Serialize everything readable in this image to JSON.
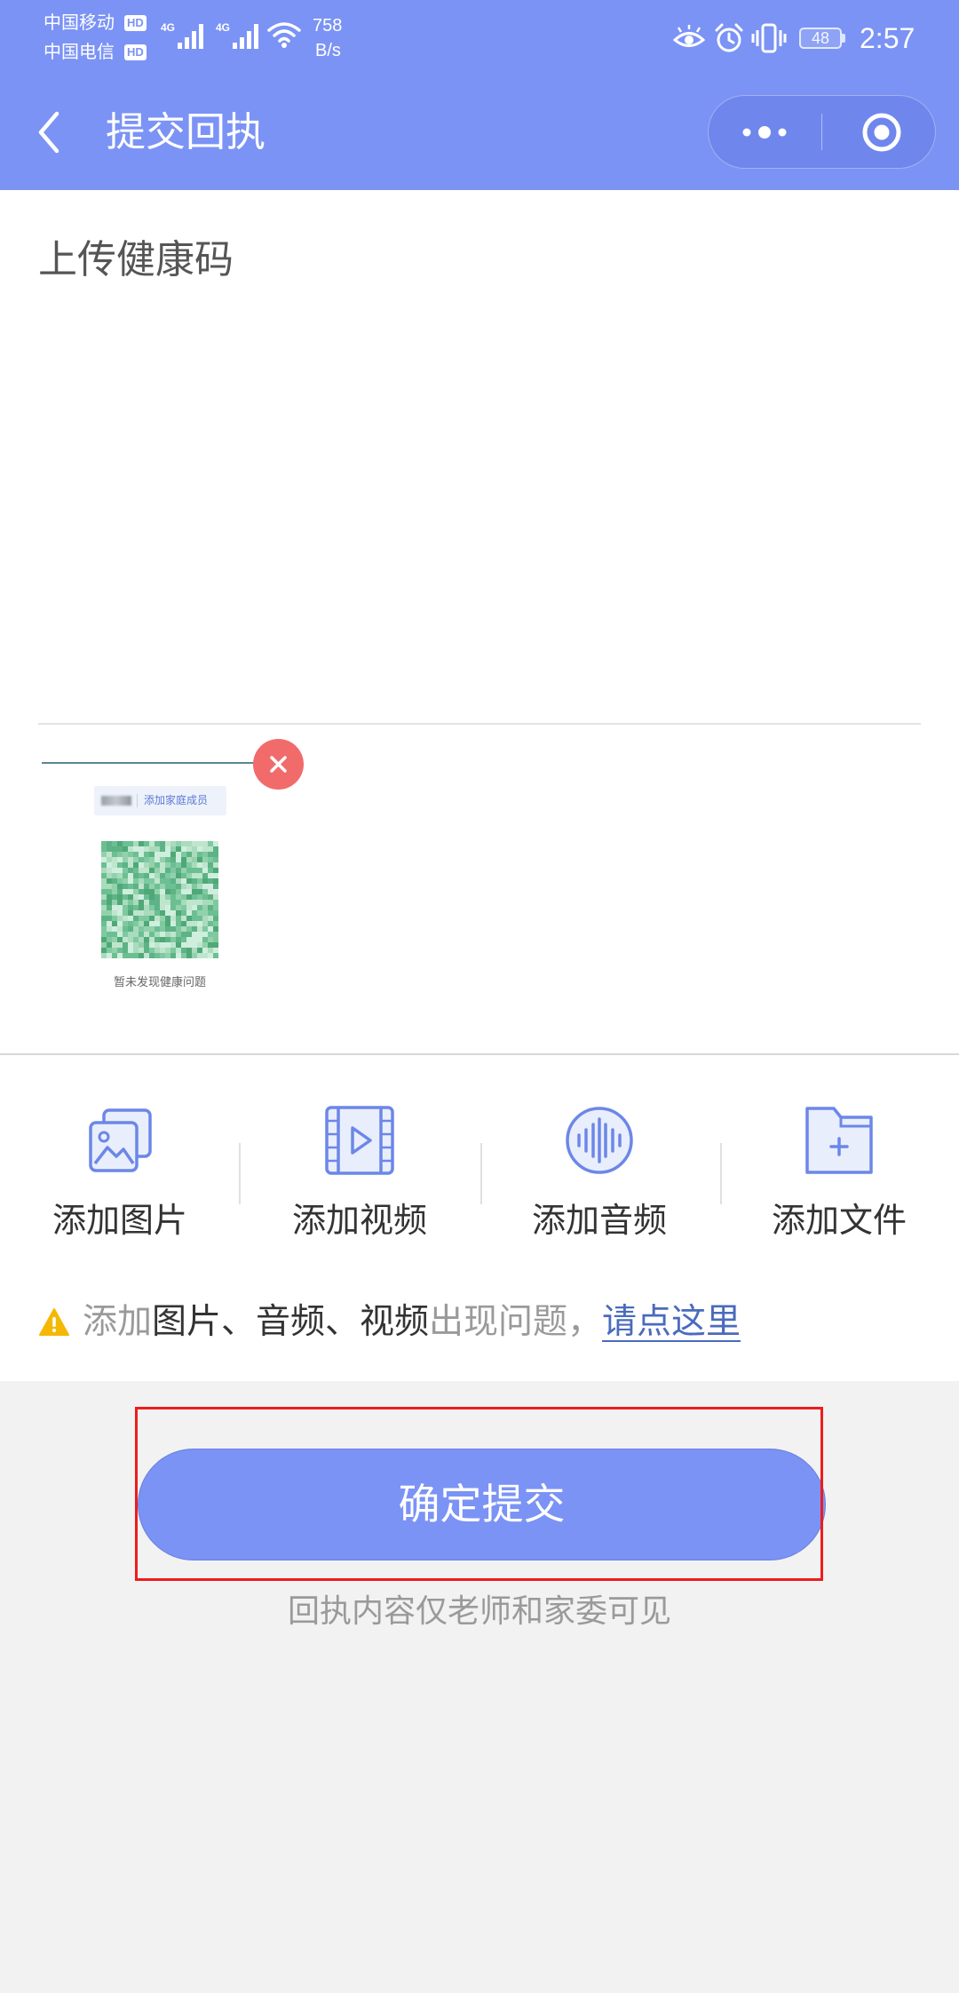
{
  "status_bar": {
    "carrier_1": "中国移动",
    "carrier_2": "中国电信",
    "hd_badge": "HD",
    "network_type": "4G",
    "speed_value": "758",
    "speed_unit": "B/s",
    "battery_level": "48",
    "time": "2:57",
    "icons": [
      "signal-icon",
      "wifi-icon",
      "eye-icon",
      "alarm-icon",
      "vibrate-icon",
      "battery-icon"
    ]
  },
  "nav": {
    "title": "提交回执",
    "icons": [
      "back-chevron-icon",
      "more-dots-icon",
      "close-target-icon"
    ]
  },
  "upload": {
    "title": "上传健康码",
    "attachment": {
      "tag_label": "添加家庭成员",
      "caption": "暂未发现健康问题",
      "delete_icon": "close-icon"
    }
  },
  "actions": [
    {
      "label": "添加图片",
      "icon": "image-icon"
    },
    {
      "label": "添加视频",
      "icon": "video-icon"
    },
    {
      "label": "添加音频",
      "icon": "audio-icon"
    },
    {
      "label": "添加文件",
      "icon": "folder-add-icon"
    }
  ],
  "notice": {
    "icon": "warning-icon",
    "prefix": "添加",
    "media": "图片、音频、视频",
    "suffix": "出现问题，",
    "link": "请点这里"
  },
  "submit": {
    "label": "确定提交"
  },
  "footer_note": "回执内容仅老师和家委可见",
  "colors": {
    "brand": "#7b93f5",
    "icon": "#6c87e8",
    "delete": "#f26b6b",
    "warning": "#f5b800",
    "link": "#4a6bbd",
    "highlight_box": "#ee1c1c"
  }
}
